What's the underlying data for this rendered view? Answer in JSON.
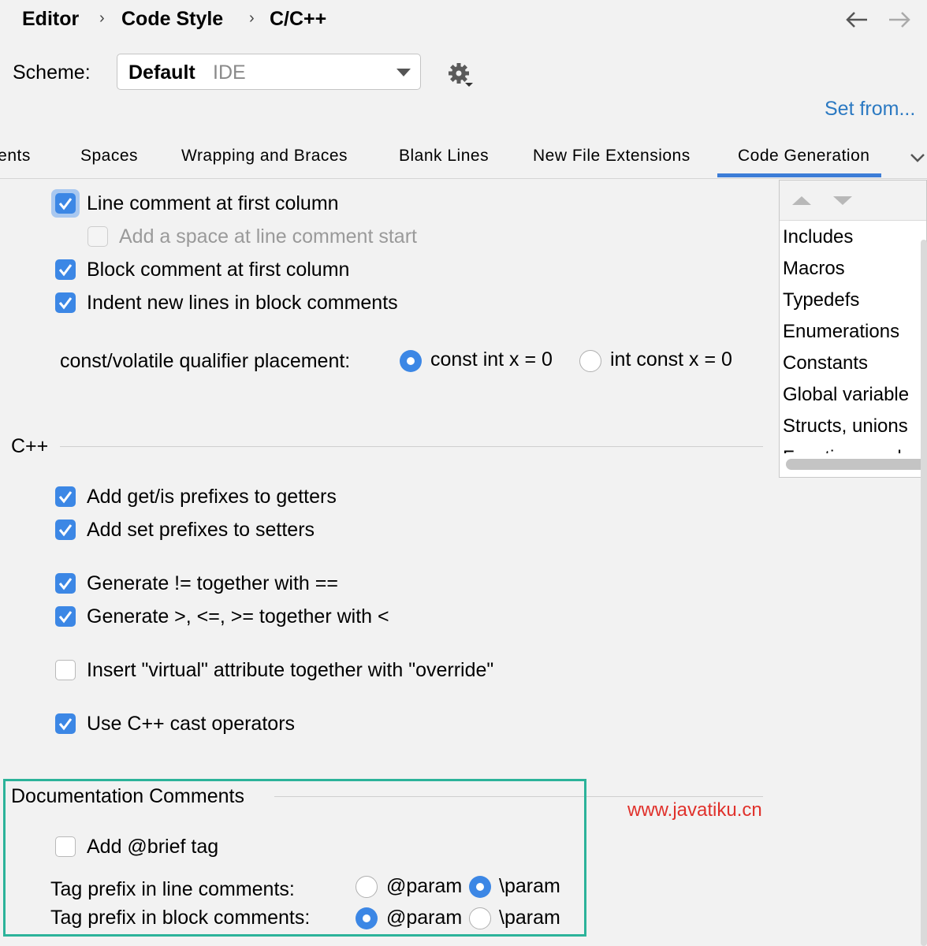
{
  "breadcrumb": [
    "Editor",
    "Code Style",
    "C/C++"
  ],
  "breadcrumb_separator": "›",
  "nav": {
    "back_icon": "arrow-left-icon",
    "forward_icon": "arrow-right-icon"
  },
  "scheme": {
    "label": "Scheme:",
    "value": "Default",
    "sub": "IDE",
    "gear_icon": "gear-icon",
    "set_from": "Set from..."
  },
  "tabs": [
    "lents",
    "Spaces",
    "Wrapping and Braces",
    "Blank Lines",
    "New File Extensions",
    "Code Generation"
  ],
  "active_tab": "Code Generation",
  "tabs_overflow_icon": "chevron-down-icon",
  "comments": {
    "line_comment_first_col": {
      "label": "Line comment at first column",
      "checked": true
    },
    "add_space": {
      "label": "Add a space at line comment start",
      "checked": false,
      "enabled": false
    },
    "block_comment_first_col": {
      "label": "Block comment at first column",
      "checked": true
    },
    "indent_block": {
      "label": "Indent new lines in block comments",
      "checked": true
    }
  },
  "qualifier": {
    "label": "const/volatile qualifier placement:",
    "option1": "const int x = 0",
    "option2": "int const x = 0",
    "selected": "const int x = 0"
  },
  "cpp_section": {
    "title": "C++",
    "getters": {
      "label": "Add get/is prefixes to getters",
      "checked": true
    },
    "setters": {
      "label": "Add set prefixes to setters",
      "checked": true
    },
    "neq": {
      "label": "Generate != together with ==",
      "checked": true
    },
    "compare": {
      "label": "Generate >, <=, >= together with <",
      "checked": true
    },
    "virtual": {
      "label": "Insert \"virtual\" attribute together with \"override\"",
      "checked": false
    },
    "cast": {
      "label": "Use C++ cast operators",
      "checked": true
    }
  },
  "order_list": {
    "items": [
      "Includes",
      "Macros",
      "Typedefs",
      "Enumerations",
      "Constants",
      "Global variable",
      "Structs, unions",
      "Functions and"
    ]
  },
  "doc_comments": {
    "title": "Documentation Comments",
    "brief": {
      "label": "Add @brief tag",
      "checked": false
    },
    "line_prefix": {
      "label": "Tag prefix in line comments:",
      "opt1": "@param",
      "opt2": "\\param",
      "selected": "\\param"
    },
    "block_prefix": {
      "label": "Tag prefix in block comments:",
      "opt1": "@param",
      "opt2": "\\param",
      "selected": "@param"
    }
  },
  "watermark": "www.javatiku.cn",
  "colors": {
    "accent": "#3c87e5",
    "highlight_box": "#2cb39a",
    "link": "#2b79c2",
    "watermark": "#e0312b"
  }
}
